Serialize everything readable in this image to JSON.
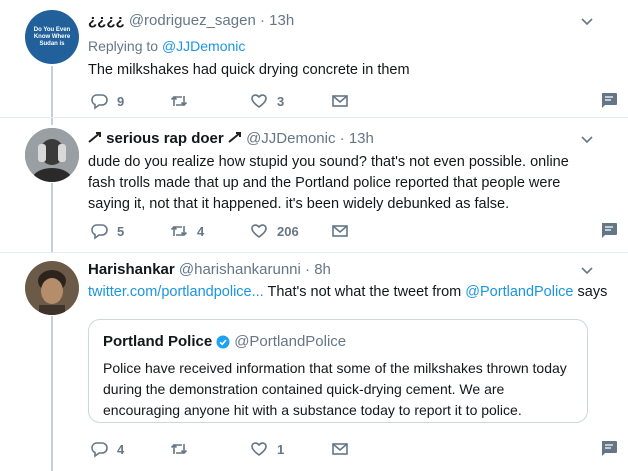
{
  "tweets": [
    {
      "name": "¿¿¿¿",
      "handle": "@rodriguez_sagen",
      "time": "13h",
      "avatar_text": "Do You Even Know Where Sudan is",
      "replying_label": "Replying to",
      "replying_handle": "@JJDemonic",
      "text": "The milkshakes had quick drying concrete in them",
      "replies": "9",
      "retweets": "",
      "likes": "3"
    },
    {
      "name": "serious rap doer",
      "handle": "@JJDemonic",
      "time": "13h",
      "text": "dude do you realize how stupid you sound? that's not even possible. online fash trolls made that up and the Portland police reported that people were saying it, not that it happened. it's been widely debunked as false.",
      "replies": "5",
      "retweets": "4",
      "likes": "206"
    },
    {
      "name": "Harishankar",
      "handle": "@harishankarunni",
      "time": "8h",
      "link_text": "twitter.com/portlandpolice...",
      "text_mid": " That's not what the tweet from ",
      "mention": "@PortlandPolice",
      "text_end": " says",
      "quote": {
        "name": "Portland Police",
        "handle": "@PortlandPolice",
        "text": "Police have received information that some of the milkshakes thrown today during the demonstration contained quick-drying cement. We are encouraging anyone hit with a substance today to report it to police."
      },
      "replies": "4",
      "retweets": "",
      "likes": "1"
    }
  ],
  "colors": {
    "accent": "#1b95e0",
    "muted": "#657786",
    "thread": "#c4cfd6"
  }
}
